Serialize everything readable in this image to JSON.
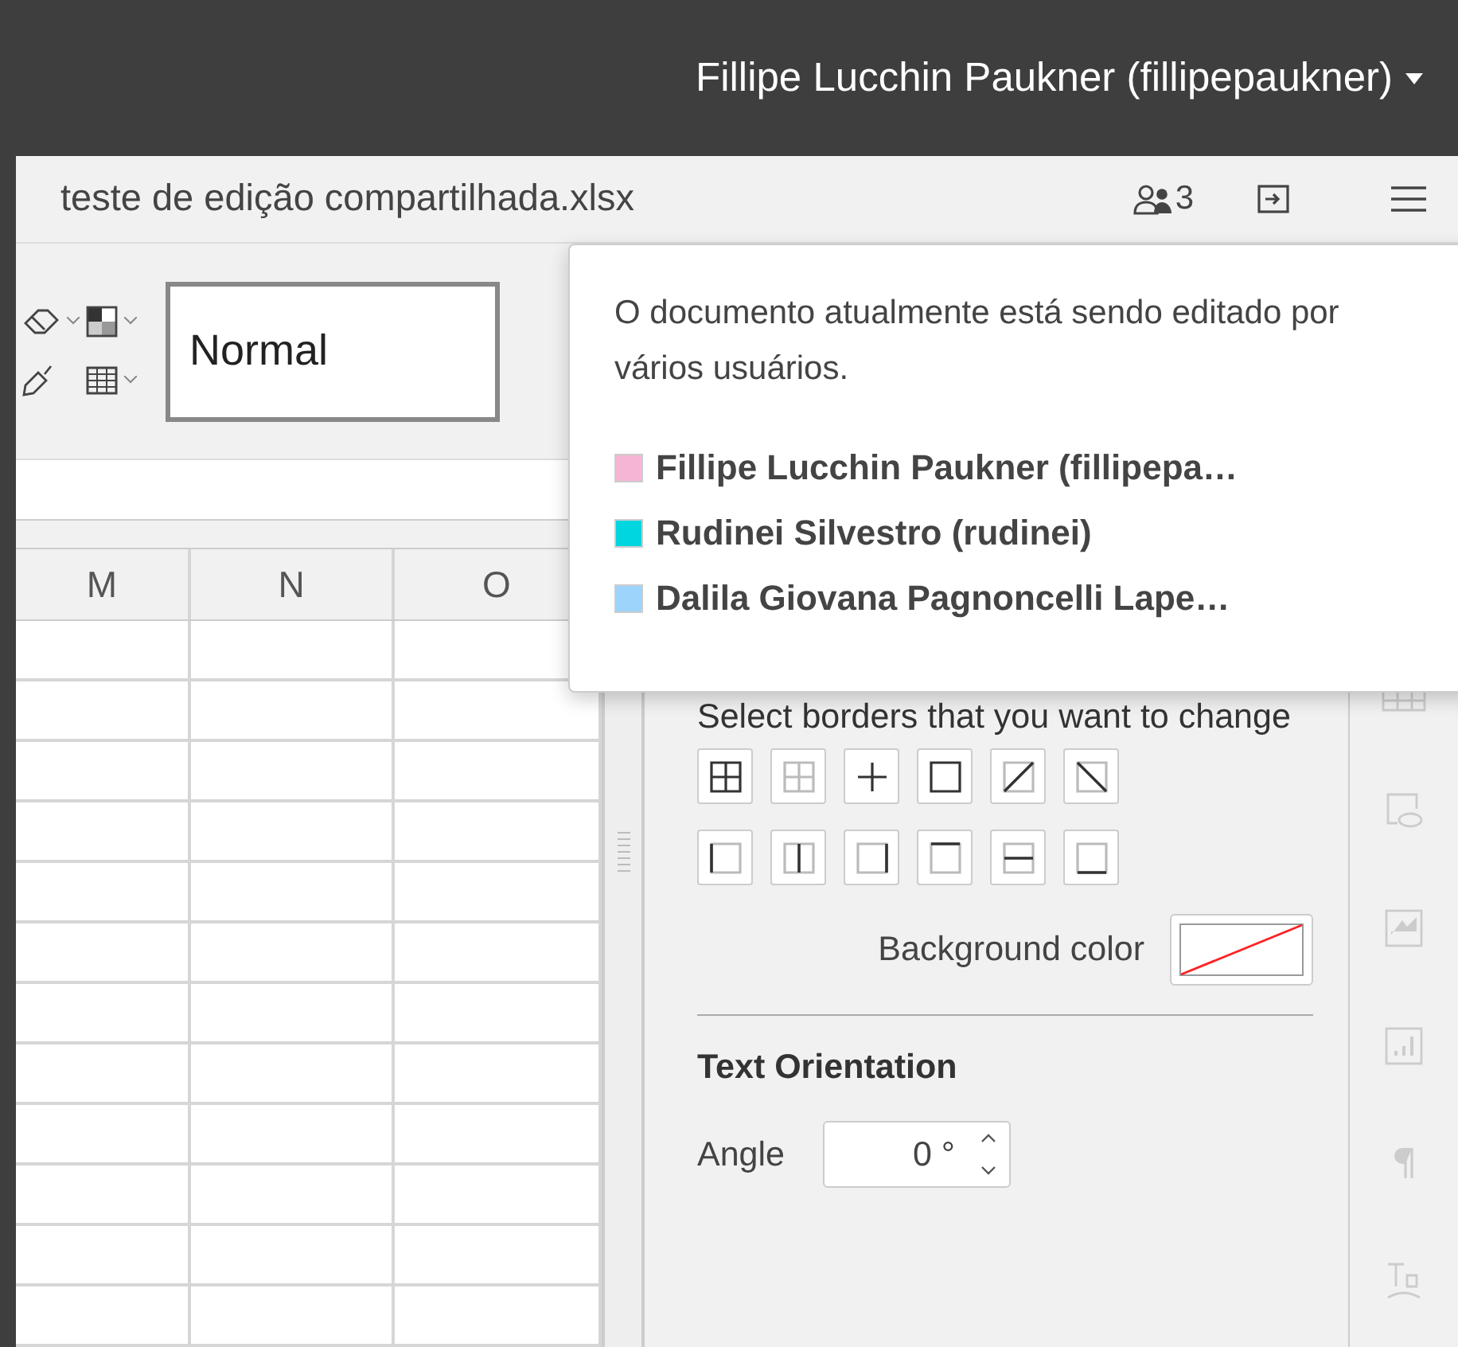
{
  "user_menu": {
    "label": "Fillipe Lucchin Paukner (fillipepaukner)"
  },
  "document": {
    "title": "teste de edição compartilhada.xlsx",
    "users_count": "3"
  },
  "toolbar": {
    "cell_style": "Normal"
  },
  "sheet": {
    "columns": [
      "M",
      "N",
      "O"
    ]
  },
  "users_popover": {
    "message": "O documento atualmente está sendo editado por vários usuários.",
    "users": [
      {
        "name": "Fillipe Lucchin Paukner (fillipepa…",
        "color": "#f7b5d6"
      },
      {
        "name": "Rudinei Silvestro (rudinei)",
        "color": "#00d6e0"
      },
      {
        "name": "Dalila Giovana Pagnoncelli Lape…",
        "color": "#9dd4fb"
      }
    ]
  },
  "settings_panel": {
    "borders_hint": "Select borders that you want to change",
    "background_color_label": "Background color",
    "text_orientation_title": "Text Orientation",
    "angle_label": "Angle",
    "angle_value": "0 °"
  }
}
